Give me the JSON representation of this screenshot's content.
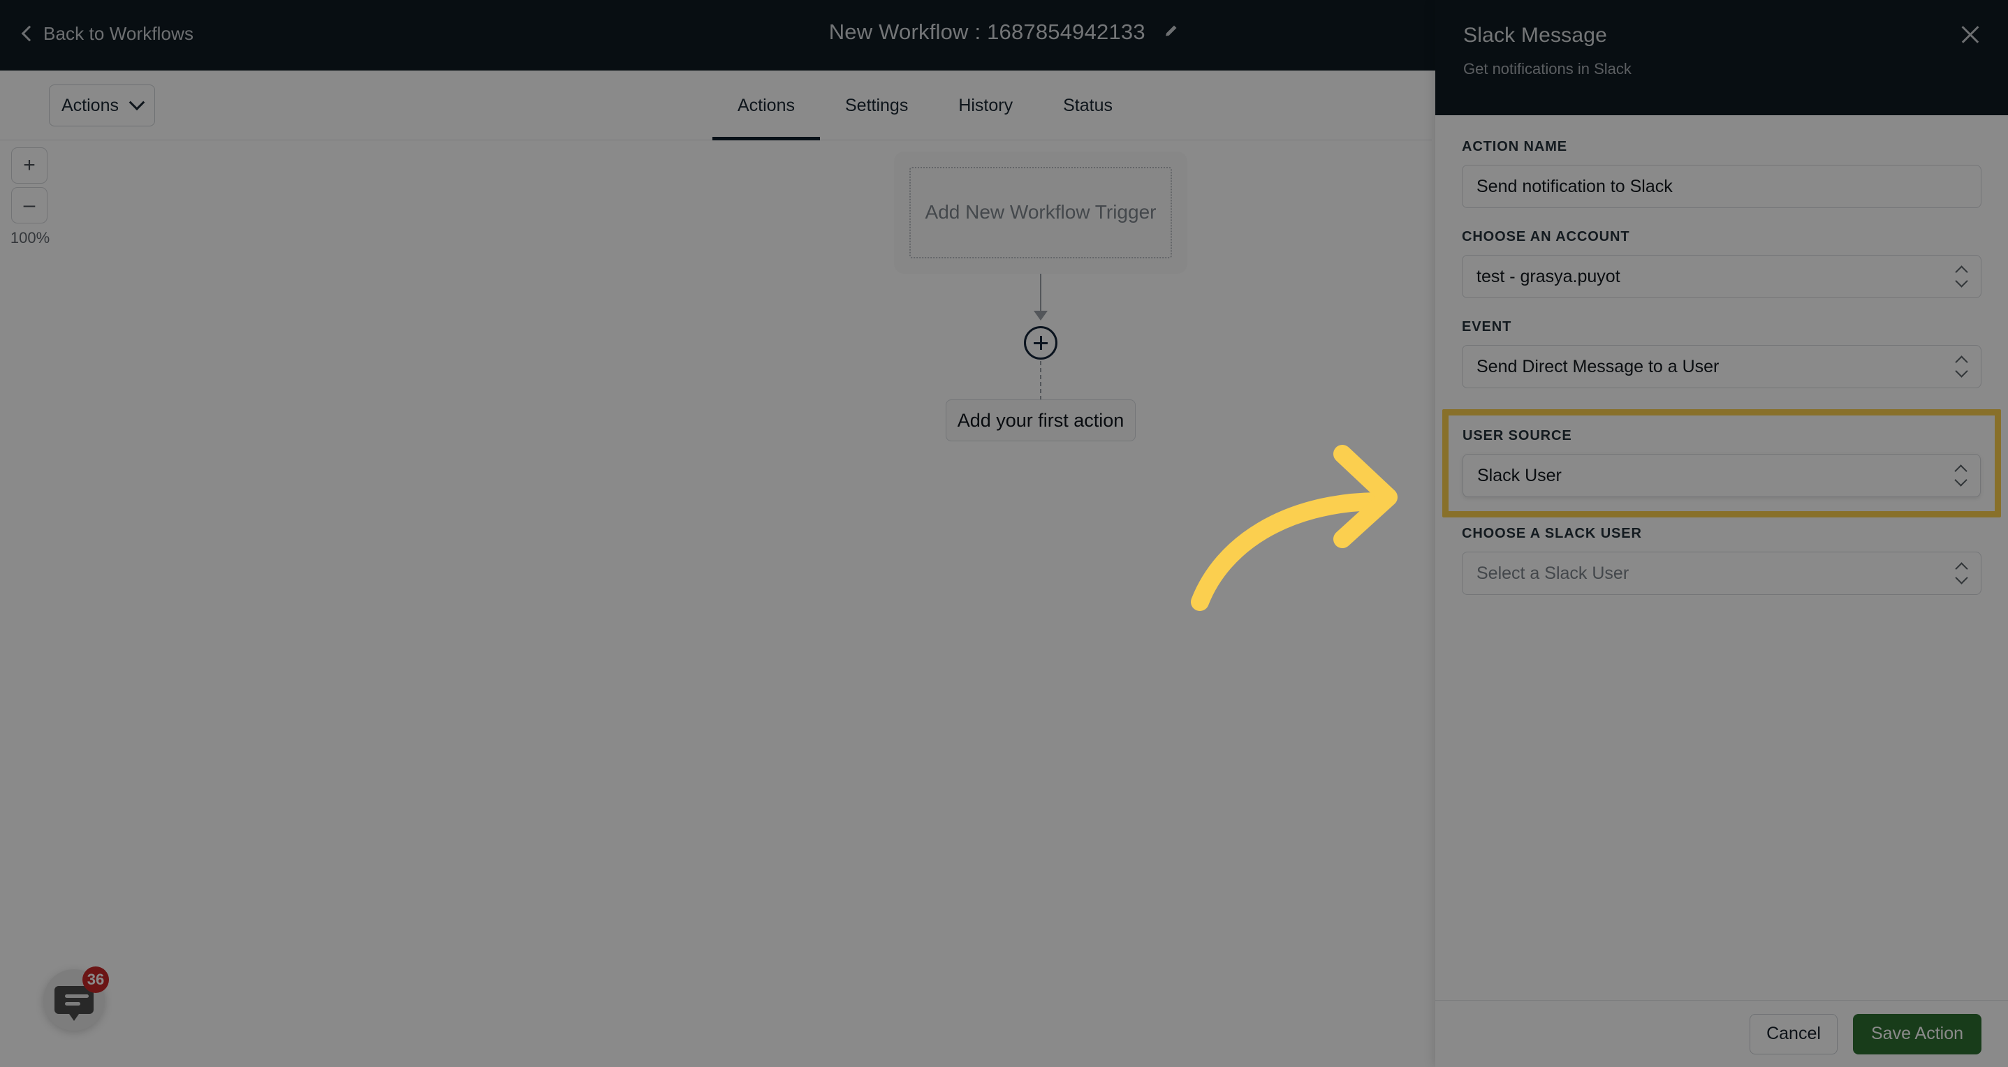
{
  "topbar": {
    "back_label": "Back to Workflows",
    "back_icon": "chevron-left-icon",
    "workflow_title": "New Workflow : 1687854942133",
    "edit_icon": "pencil-icon"
  },
  "toolbar": {
    "actions_button": "Actions",
    "actions_caret_icon": "chevron-down-icon",
    "tabs": [
      {
        "label": "Actions",
        "active": true
      },
      {
        "label": "Settings",
        "active": false
      },
      {
        "label": "History",
        "active": false
      },
      {
        "label": "Status",
        "active": false
      }
    ]
  },
  "canvas": {
    "zoom": {
      "zoom_in_icon": "plus-icon",
      "zoom_in_label": "+",
      "zoom_out_icon": "minus-icon",
      "zoom_out_label": "–",
      "level": "100%"
    },
    "trigger_card_label": "Add New Workflow Trigger",
    "add_node_icon": "plus-circle-icon",
    "first_action_label": "Add your first action",
    "chat_widget": {
      "icon": "chat-bubble-icon",
      "badge": "36"
    }
  },
  "panel": {
    "title": "Slack Message",
    "subtitle": "Get notifications in Slack",
    "close_icon": "close-icon",
    "fields": [
      {
        "label": "ACTION NAME",
        "value": "Send notification to Slack",
        "type": "text",
        "placeholder": "",
        "highlighted": false
      },
      {
        "label": "CHOOSE AN ACCOUNT",
        "value": "test - grasya.puyot",
        "type": "select",
        "placeholder": "",
        "highlighted": false
      },
      {
        "label": "EVENT",
        "value": "Send Direct Message to a User",
        "type": "select",
        "placeholder": "",
        "highlighted": false
      },
      {
        "label": "USER SOURCE",
        "value": "Slack User",
        "type": "select",
        "placeholder": "",
        "highlighted": true
      },
      {
        "label": "CHOOSE A SLACK USER",
        "value": "",
        "type": "select",
        "placeholder": "Select a Slack User",
        "highlighted": false
      }
    ],
    "footer": {
      "cancel_label": "Cancel",
      "save_label": "Save Action"
    }
  },
  "annotation": {
    "arrow_icon": "curved-arrow-right-icon",
    "color": "#FBCF4F"
  },
  "colors": {
    "header_dark": "#0F1A22",
    "highlight_yellow": "#FBCF4F",
    "save_green": "#2E7031",
    "badge_red": "#C62828",
    "active_tab_underline": "#12212E"
  }
}
